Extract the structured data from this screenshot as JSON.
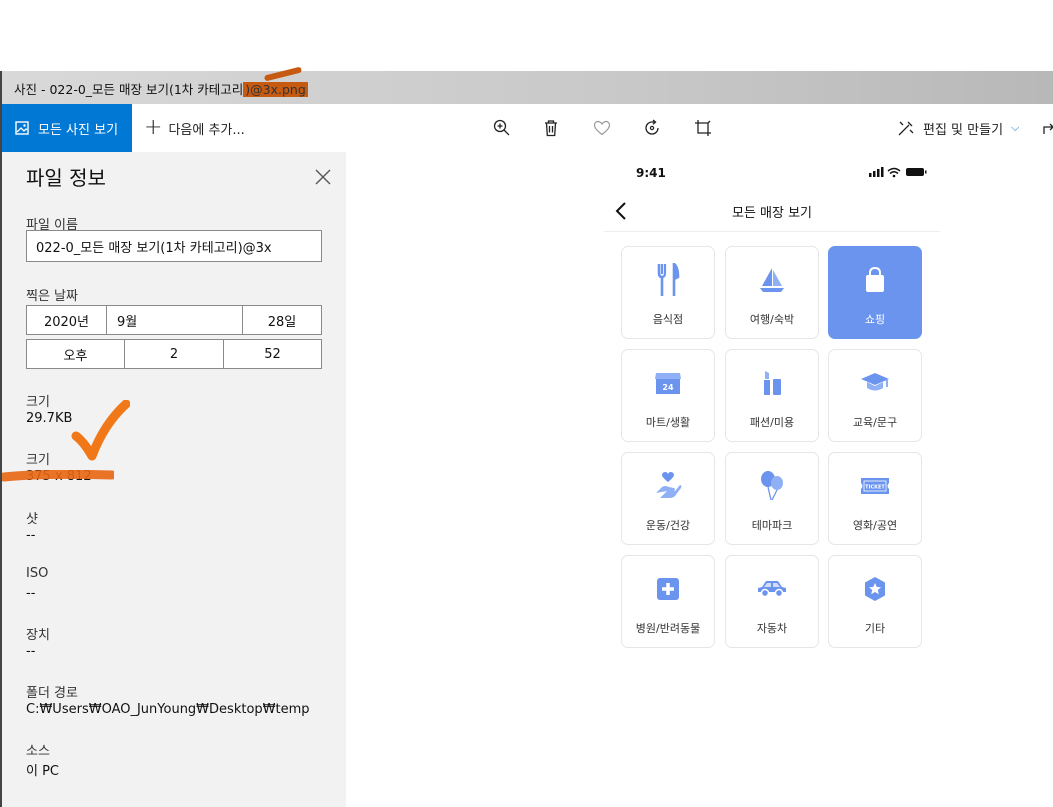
{
  "window": {
    "title_prefix": "사진 - 022-0_모든 매장 보기(1차 카테고리",
    "title_highlight": ")@3x.png"
  },
  "toolbar": {
    "all_photos_label": "모든 사진 보기",
    "add_to_label": "다음에 추가...",
    "edit_create_label": "편집 및 만들기"
  },
  "info_panel": {
    "title": "파일 정보",
    "file_name_label": "파일 이름",
    "file_name_value": "022-0_모든 매장 보기(1차 카테고리)@3x",
    "date_taken_label": "찍은 날짜",
    "date": {
      "year": "2020년",
      "month": "9월",
      "day": "28일"
    },
    "time": {
      "ampm": "오후",
      "hour": "2",
      "minute": "52"
    },
    "size_label": "크기",
    "size_value": "29.7KB",
    "dimensions_label": "크기",
    "dimensions_value": "375 x 812",
    "shutter_label": "샷",
    "shutter_value": "--",
    "iso_label": "ISO",
    "iso_value": "--",
    "device_label": "장치",
    "device_value": "--",
    "folder_label": "폴더 경로",
    "folder_value": "C:₩Users₩OAO_JunYoung₩Desktop₩temp",
    "source_label": "소스",
    "source_value": "이 PC"
  },
  "phone": {
    "status_time": "9:41",
    "nav_title": "모든 매장 보기",
    "accent_color": "#6a94ee",
    "categories": [
      {
        "label": "음식점",
        "icon": "fork-knife-icon",
        "selected": false
      },
      {
        "label": "여행/숙박",
        "icon": "sailboat-icon",
        "selected": false
      },
      {
        "label": "쇼핑",
        "icon": "shopping-bag-icon",
        "selected": true
      },
      {
        "label": "마트/생활",
        "icon": "store-24-icon",
        "selected": false
      },
      {
        "label": "패션/미용",
        "icon": "cosmetics-icon",
        "selected": false
      },
      {
        "label": "교육/문구",
        "icon": "graduation-cap-icon",
        "selected": false
      },
      {
        "label": "운동/건강",
        "icon": "hand-heart-icon",
        "selected": false
      },
      {
        "label": "테마파크",
        "icon": "balloons-icon",
        "selected": false
      },
      {
        "label": "영화/공연",
        "icon": "ticket-icon",
        "selected": false
      },
      {
        "label": "병원/반려동물",
        "icon": "medical-cross-icon",
        "selected": false
      },
      {
        "label": "자동차",
        "icon": "car-icon",
        "selected": false
      },
      {
        "label": "기타",
        "icon": "badge-icon",
        "selected": false
      }
    ],
    "ticket_text": "TICKET",
    "store_badge_text": "24"
  }
}
